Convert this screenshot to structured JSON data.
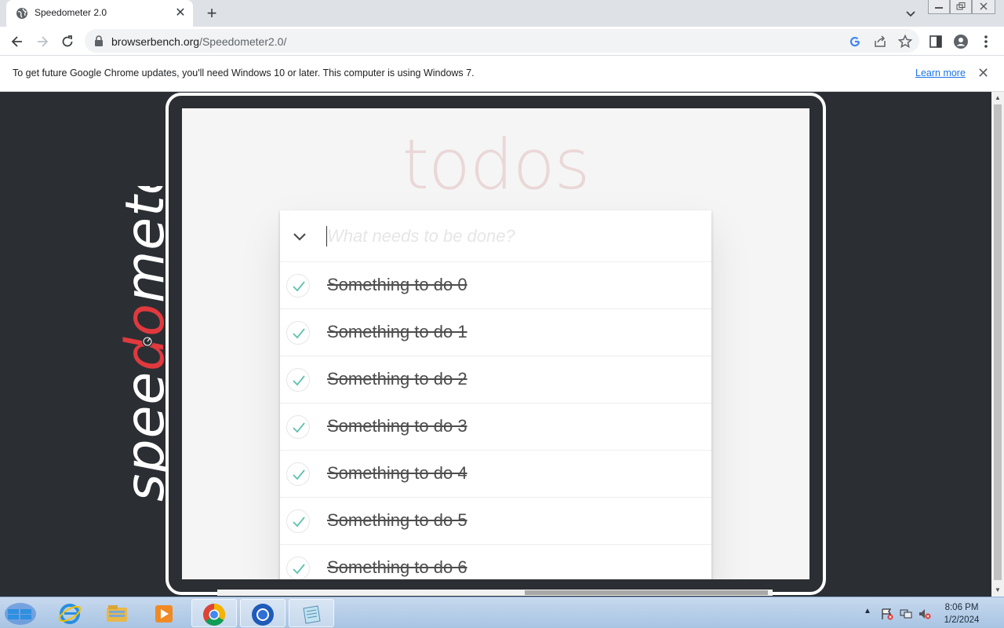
{
  "browser": {
    "tab_title": "Speedometer 2.0",
    "url_host": "browserbench.org",
    "url_path": "/Speedometer2.0/"
  },
  "infobar": {
    "message": "To get future Google Chrome updates, you'll need Windows 10 or later. This computer is using Windows 7.",
    "learn_more": "Learn more"
  },
  "logo": {
    "text": "speedometer",
    "accent_color": "#e0393e"
  },
  "todo_app": {
    "title": "todos",
    "placeholder": "What needs to be done?",
    "items": [
      {
        "label": "Something to do 0",
        "completed": true
      },
      {
        "label": "Something to do 1",
        "completed": true
      },
      {
        "label": "Something to do 2",
        "completed": true
      },
      {
        "label": "Something to do 3",
        "completed": true
      },
      {
        "label": "Something to do 4",
        "completed": true
      },
      {
        "label": "Something to do 5",
        "completed": true
      },
      {
        "label": "Something to do 6",
        "completed": true
      }
    ]
  },
  "taskbar": {
    "apps": [
      "internet-explorer-icon",
      "file-explorer-icon",
      "media-player-icon",
      "chrome-icon",
      "chromium-icon",
      "notepad-icon"
    ],
    "time": "8:06 PM",
    "date": "1/2/2024"
  }
}
